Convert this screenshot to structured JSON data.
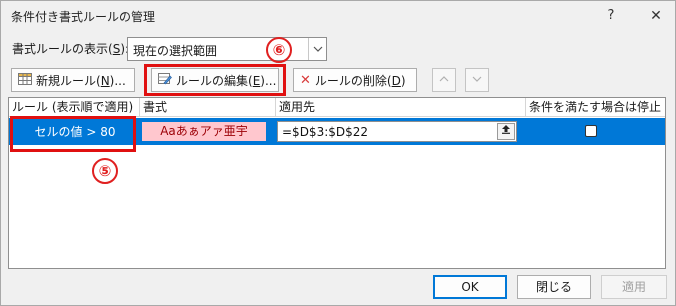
{
  "window": {
    "title": "条件付き書式ルールの管理",
    "help_label": "?",
    "close_label": "✕"
  },
  "show_rules": {
    "label_prefix": "書式ルールの表示(",
    "label_key": "S",
    "label_suffix": "):",
    "selected_value": "現在の選択範囲"
  },
  "annotations": {
    "step5": "⑤",
    "step6": "⑥",
    "highlight_color": "#e01010"
  },
  "toolbar": {
    "new_rule": {
      "prefix": "新規ルール(",
      "key": "N",
      "suffix": ")..."
    },
    "edit_rule": {
      "prefix": "ルールの編集(",
      "key": "E",
      "suffix": ")..."
    },
    "delete_rule": {
      "prefix": "ルールの削除(",
      "key": "D",
      "suffix": ")"
    },
    "move_up_icon": "chevron-up-icon",
    "move_down_icon": "chevron-down-icon"
  },
  "grid": {
    "headers": [
      "ルール (表示順で適用)",
      "書式",
      "適用先",
      "条件を満たす場合は停止"
    ],
    "rows": [
      {
        "rule": "セルの値 > 80",
        "format_sample": "Aaあぁアァ亜宇",
        "applies_to": "=$D$3:$D$22",
        "stop_if_true": false
      }
    ],
    "selection_color": "#0078d7",
    "format_fill": "#ffc7ce",
    "format_text_color": "#9c0006"
  },
  "buttons": {
    "ok": "OK",
    "close": "閉じる",
    "apply": "適用"
  }
}
